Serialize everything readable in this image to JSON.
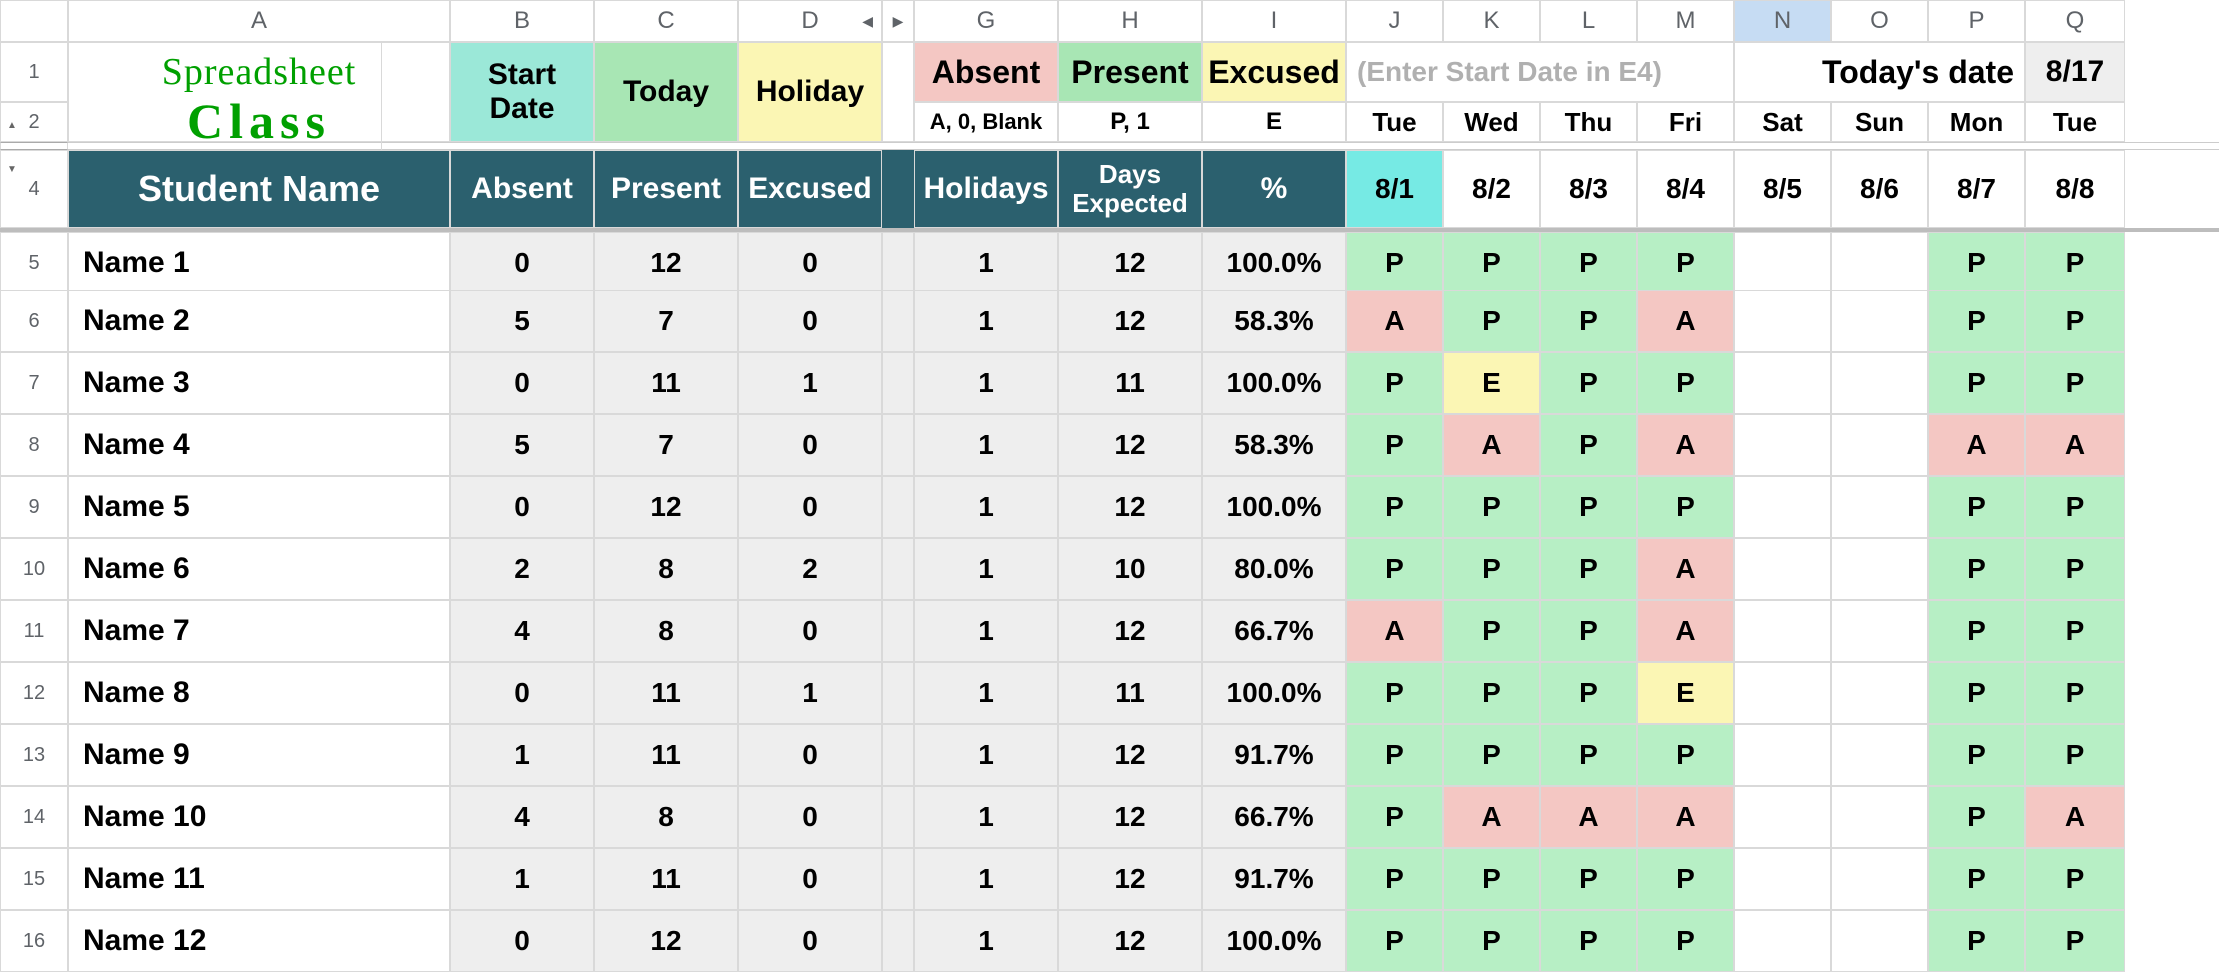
{
  "columns": [
    "",
    "A",
    "B",
    "C",
    "D",
    "G",
    "H",
    "I",
    "J",
    "K",
    "L",
    "M",
    "N",
    "O",
    "P",
    "Q"
  ],
  "selected_column_index": 12,
  "logo": {
    "line1": "Spreadsheet",
    "line2": "Class"
  },
  "header_top": {
    "start_date": "Start Date",
    "today": "Today",
    "holiday": "Holiday",
    "absent": "Absent",
    "present": "Present",
    "excused": "Excused",
    "hint": "(Enter Start Date in E4)",
    "todays_date_label": "Today's date",
    "todays_date_value": "8/17"
  },
  "header_sub": {
    "absent_codes": "A, 0, Blank",
    "present_codes": "P, 1",
    "excused_codes": "E",
    "day_names": [
      "Tue",
      "Wed",
      "Thu",
      "Fri",
      "Sat",
      "Sun",
      "Mon",
      "Tue"
    ]
  },
  "header_main": {
    "student": "Student Name",
    "absent": "Absent",
    "present": "Present",
    "excused": "Excused",
    "holidays": "Holidays",
    "days_expected": "Days Expected",
    "percent": "%",
    "dates": [
      "8/1",
      "8/2",
      "8/3",
      "8/4",
      "8/5",
      "8/6",
      "8/7",
      "8/8"
    ]
  },
  "row_numbers": [
    "1",
    "2",
    "4",
    "5",
    "6",
    "7",
    "8",
    "9",
    "10",
    "11",
    "12",
    "13",
    "14",
    "15",
    "16"
  ],
  "students": [
    {
      "name": "Name 1",
      "absent": "0",
      "present": "12",
      "excused": "0",
      "holidays": "1",
      "days": "12",
      "pct": "100.0%",
      "att": [
        "P",
        "P",
        "P",
        "P",
        "",
        "",
        "P",
        "P"
      ]
    },
    {
      "name": "Name 2",
      "absent": "5",
      "present": "7",
      "excused": "0",
      "holidays": "1",
      "days": "12",
      "pct": "58.3%",
      "att": [
        "A",
        "P",
        "P",
        "A",
        "",
        "",
        "P",
        "P"
      ]
    },
    {
      "name": "Name 3",
      "absent": "0",
      "present": "11",
      "excused": "1",
      "holidays": "1",
      "days": "11",
      "pct": "100.0%",
      "att": [
        "P",
        "E",
        "P",
        "P",
        "",
        "",
        "P",
        "P"
      ]
    },
    {
      "name": "Name 4",
      "absent": "5",
      "present": "7",
      "excused": "0",
      "holidays": "1",
      "days": "12",
      "pct": "58.3%",
      "att": [
        "P",
        "A",
        "P",
        "A",
        "",
        "",
        "A",
        "A"
      ]
    },
    {
      "name": "Name 5",
      "absent": "0",
      "present": "12",
      "excused": "0",
      "holidays": "1",
      "days": "12",
      "pct": "100.0%",
      "att": [
        "P",
        "P",
        "P",
        "P",
        "",
        "",
        "P",
        "P"
      ]
    },
    {
      "name": "Name 6",
      "absent": "2",
      "present": "8",
      "excused": "2",
      "holidays": "1",
      "days": "10",
      "pct": "80.0%",
      "att": [
        "P",
        "P",
        "P",
        "A",
        "",
        "",
        "P",
        "P"
      ]
    },
    {
      "name": "Name 7",
      "absent": "4",
      "present": "8",
      "excused": "0",
      "holidays": "1",
      "days": "12",
      "pct": "66.7%",
      "att": [
        "A",
        "P",
        "P",
        "A",
        "",
        "",
        "P",
        "P"
      ]
    },
    {
      "name": "Name 8",
      "absent": "0",
      "present": "11",
      "excused": "1",
      "holidays": "1",
      "days": "11",
      "pct": "100.0%",
      "att": [
        "P",
        "P",
        "P",
        "E",
        "",
        "",
        "P",
        "P"
      ]
    },
    {
      "name": "Name 9",
      "absent": "1",
      "present": "11",
      "excused": "0",
      "holidays": "1",
      "days": "12",
      "pct": "91.7%",
      "att": [
        "P",
        "P",
        "P",
        "P",
        "",
        "",
        "P",
        "P"
      ]
    },
    {
      "name": "Name 10",
      "absent": "4",
      "present": "8",
      "excused": "0",
      "holidays": "1",
      "days": "12",
      "pct": "66.7%",
      "att": [
        "P",
        "A",
        "A",
        "A",
        "",
        "",
        "P",
        "A"
      ]
    },
    {
      "name": "Name 11",
      "absent": "1",
      "present": "11",
      "excused": "0",
      "holidays": "1",
      "days": "12",
      "pct": "91.7%",
      "att": [
        "P",
        "P",
        "P",
        "P",
        "",
        "",
        "P",
        "P"
      ]
    },
    {
      "name": "Name 12",
      "absent": "0",
      "present": "12",
      "excused": "0",
      "holidays": "1",
      "days": "12",
      "pct": "100.0%",
      "att": [
        "P",
        "P",
        "P",
        "P",
        "",
        "",
        "P",
        "P"
      ]
    }
  ]
}
